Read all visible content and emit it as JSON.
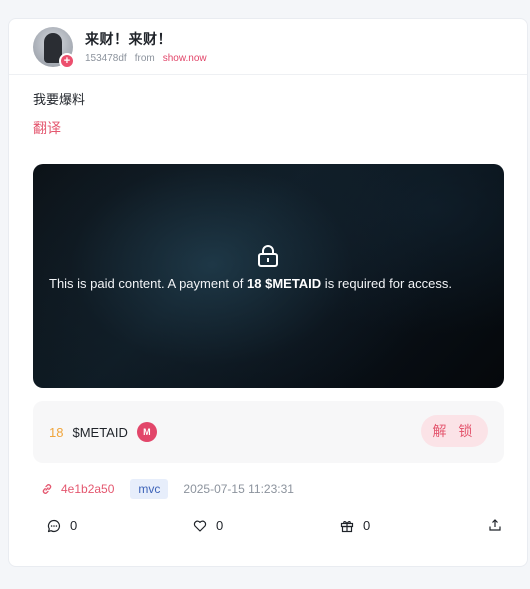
{
  "post": {
    "author": {
      "name": "来财！来财！",
      "id": "153478df",
      "from_label": "from",
      "source": "show.now"
    },
    "text": "我要爆料",
    "translate_label": "翻译",
    "paid_content": {
      "message_prefix": "This is paid content. A payment of ",
      "message_amount": "18 $METAID",
      "message_suffix": " is required for access."
    },
    "unlock": {
      "amount": "18",
      "token": "$METAID",
      "token_badge": "M",
      "button_label": "解 锁"
    },
    "tx": {
      "hash": "4e1b2a50",
      "chain": "mvc",
      "timestamp": "2025-07-15 11:23:31"
    },
    "actions": {
      "comments": "0",
      "likes": "0",
      "gifts": "0"
    }
  },
  "colors": {
    "accent": "#e4576f",
    "price": "#f0a53c",
    "chain_tag_bg": "#e7eefb"
  },
  "icons": [
    "lock-icon",
    "link-icon",
    "comment-icon",
    "heart-icon",
    "gift-icon",
    "share-icon",
    "add-icon"
  ]
}
